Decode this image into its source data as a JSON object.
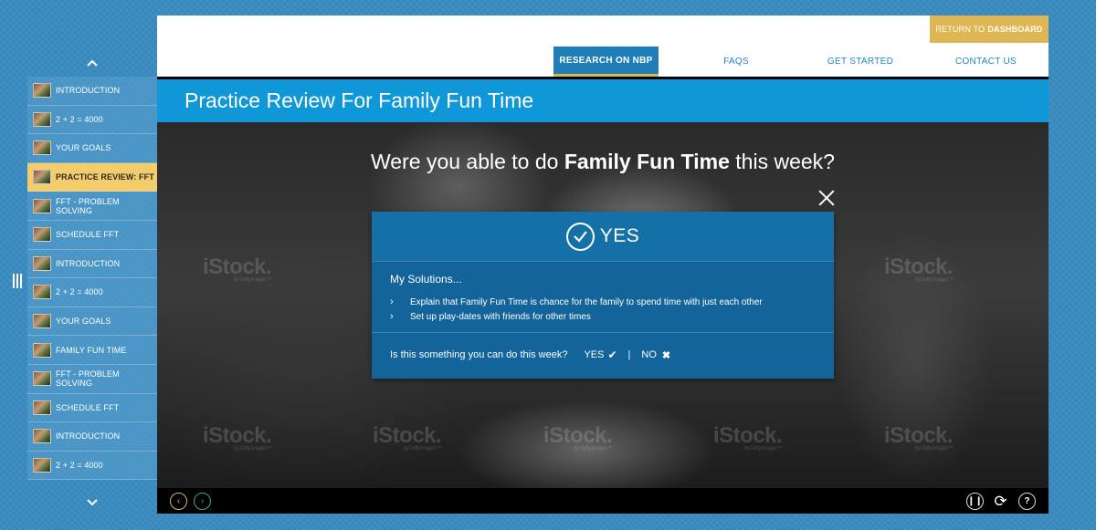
{
  "sidebar": {
    "items": [
      {
        "label": "INTRODUCTION",
        "active": false
      },
      {
        "label": "2 + 2 = 4000",
        "active": false
      },
      {
        "label": "YOUR GOALS",
        "active": false
      },
      {
        "label": "PRACTICE REVIEW: FFT",
        "active": true
      },
      {
        "label": "FFT - PROBLEM SOLVING",
        "active": false
      },
      {
        "label": "SCHEDULE FFT",
        "active": false
      },
      {
        "label": "INTRODUCTION",
        "active": false
      },
      {
        "label": "2 + 2 = 4000",
        "active": false
      },
      {
        "label": "YOUR GOALS",
        "active": false
      },
      {
        "label": "FAMILY FUN TIME",
        "active": false
      },
      {
        "label": "FFT - PROBLEM SOLVING",
        "active": false
      },
      {
        "label": "SCHEDULE FFT",
        "active": false
      },
      {
        "label": "INTRODUCTION",
        "active": false
      },
      {
        "label": "2 + 2 = 4000",
        "active": false
      }
    ]
  },
  "header": {
    "dashboard_prefix": "RETURN TO",
    "dashboard_bold": "DASHBOARD",
    "nav": [
      "RESEARCH ON NBP",
      "FAQS",
      "GET STARTED",
      "CONTACT US"
    ],
    "active_nav": "RESEARCH ON NBP"
  },
  "page": {
    "title": "Practice Review For Family Fun Time"
  },
  "question": {
    "pre": "Were you able to do",
    "bold": "Family Fun Time",
    "post": "this week?"
  },
  "modal": {
    "answer": "YES",
    "solutions_title": "My Solutions...",
    "solutions": [
      "Explain that Family Fun Time is chance for the family to spend time with just each other",
      "Set up play-dates with friends for other times"
    ],
    "prompt": "Is this something you can do this week?",
    "yes_label": "YES",
    "no_label": "NO",
    "separator": "|"
  },
  "watermark": {
    "brand": "iStock.",
    "sub": "by Getty Images™"
  },
  "colors": {
    "accent_blue": "#0f97d8",
    "gold": "#deb654",
    "modal_blue": "#13649a",
    "next_green": "#3fae77"
  }
}
